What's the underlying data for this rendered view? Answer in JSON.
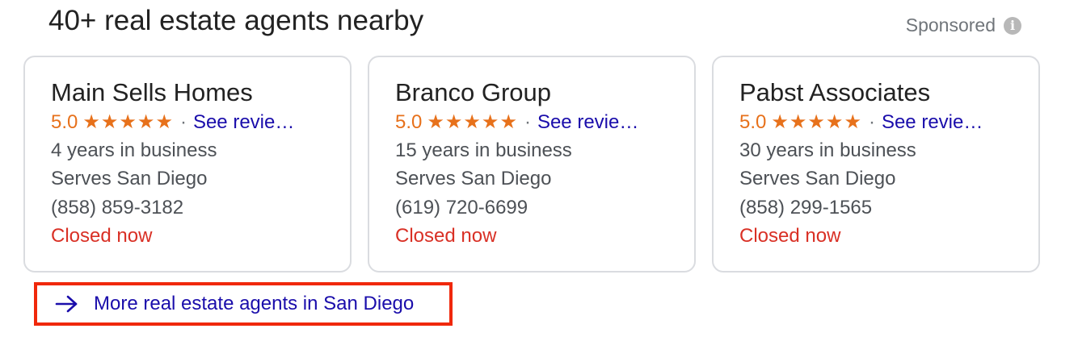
{
  "header": {
    "title": "40+ real estate agents nearby",
    "sponsored_label": "Sponsored",
    "info_icon": "info-icon",
    "info_glyph": "i"
  },
  "colors": {
    "rating": "#e7711b",
    "link": "#1a0dab",
    "closed": "#d93025",
    "highlight_border": "#f0280b"
  },
  "cards": [
    {
      "name": "Main Sells Homes",
      "rating": "5.0",
      "stars": "★★★★★",
      "separator": "·",
      "reviews_link": "See revie…",
      "years": "4 years in business",
      "serves": "Serves San Diego",
      "phone": "(858) 859-3182",
      "status": "Closed now"
    },
    {
      "name": "Branco Group",
      "rating": "5.0",
      "stars": "★★★★★",
      "separator": "·",
      "reviews_link": "See revie…",
      "years": "15 years in business",
      "serves": "Serves San Diego",
      "phone": "(619) 720-6699",
      "status": "Closed now"
    },
    {
      "name": "Pabst Associates",
      "rating": "5.0",
      "stars": "★★★★★",
      "separator": "·",
      "reviews_link": "See revie…",
      "years": "30 years in business",
      "serves": "Serves San Diego",
      "phone": "(858) 299-1565",
      "status": "Closed now"
    }
  ],
  "more_link": {
    "label": "More real estate agents in San Diego",
    "icon": "arrow-right-icon"
  }
}
